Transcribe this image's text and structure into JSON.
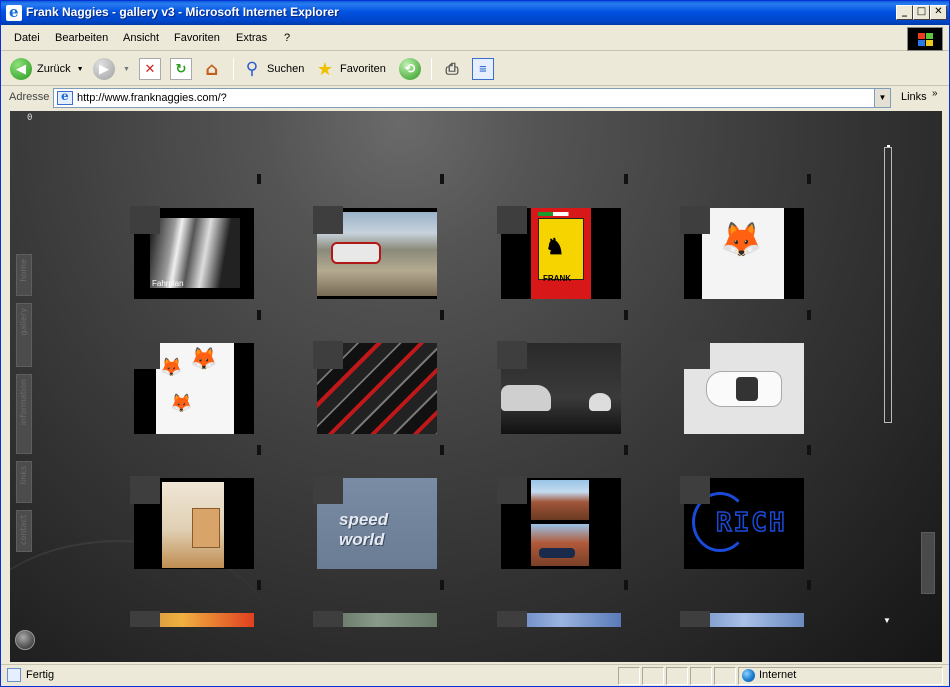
{
  "window": {
    "title": "Frank Naggies - gallery v3 - Microsoft Internet Explorer"
  },
  "menu": [
    "Datei",
    "Bearbeiten",
    "Ansicht",
    "Favoriten",
    "Extras",
    "?"
  ],
  "toolbar": {
    "back_label": "Zurück",
    "search_label": "Suchen",
    "favorites_label": "Favoriten"
  },
  "address": {
    "label": "Adresse",
    "url": "http://www.franknaggies.com/?",
    "links_label": "Links"
  },
  "gallery": {
    "counter": "0",
    "nav_tabs": [
      "home",
      "gallery",
      "information",
      "links",
      "contact"
    ],
    "tiles": [
      {
        "name": "fahrplan",
        "caption": "Fahrplan"
      },
      {
        "name": "rally-car",
        "caption": ""
      },
      {
        "name": "ferrari-frank",
        "caption": "FRANK"
      },
      {
        "name": "fox-sketch",
        "caption": ""
      },
      {
        "name": "fox-sketches",
        "caption": ""
      },
      {
        "name": "red-black-design",
        "caption": ""
      },
      {
        "name": "sports-car-helmet",
        "caption": ""
      },
      {
        "name": "white-car-topview",
        "caption": ""
      },
      {
        "name": "interior-room",
        "caption": ""
      },
      {
        "name": "speed-world",
        "caption": "speed world"
      },
      {
        "name": "desert-rocks-car",
        "caption": ""
      },
      {
        "name": "rich-logo",
        "caption": "RICH"
      },
      {
        "name": "orange-gradient",
        "caption": ""
      },
      {
        "name": "blurred-landscape",
        "caption": ""
      },
      {
        "name": "blue-sky-1",
        "caption": ""
      },
      {
        "name": "blue-sky-2",
        "caption": ""
      }
    ]
  },
  "status": {
    "text": "Fertig",
    "zone": "Internet"
  },
  "colors": {
    "title_bar": "#0052e0",
    "chrome": "#ece9d8",
    "content_bg": "#3c3c3c"
  }
}
